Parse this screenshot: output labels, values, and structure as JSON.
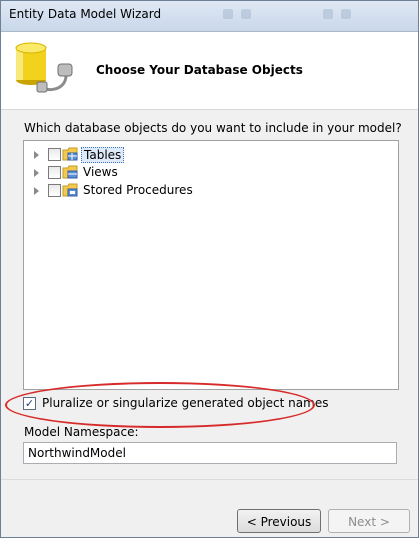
{
  "window": {
    "title": "Entity Data Model Wizard"
  },
  "header": {
    "title": "Choose Your Database Objects"
  },
  "tree": {
    "question": "Which database objects do you want to include in your model?",
    "items": [
      {
        "label": "Tables",
        "checked": false,
        "selected": true
      },
      {
        "label": "Views",
        "checked": false,
        "selected": false
      },
      {
        "label": "Stored Procedures",
        "checked": false,
        "selected": false
      }
    ]
  },
  "options": {
    "pluralize_label": "Pluralize or singularize generated object names",
    "pluralize_checked": true,
    "highlight_color": "#d72a2a"
  },
  "namespace": {
    "label": "Model Namespace:",
    "value": "NorthwindModel"
  },
  "footer": {
    "previous_label": "< Previous",
    "next_label": "Next >"
  }
}
